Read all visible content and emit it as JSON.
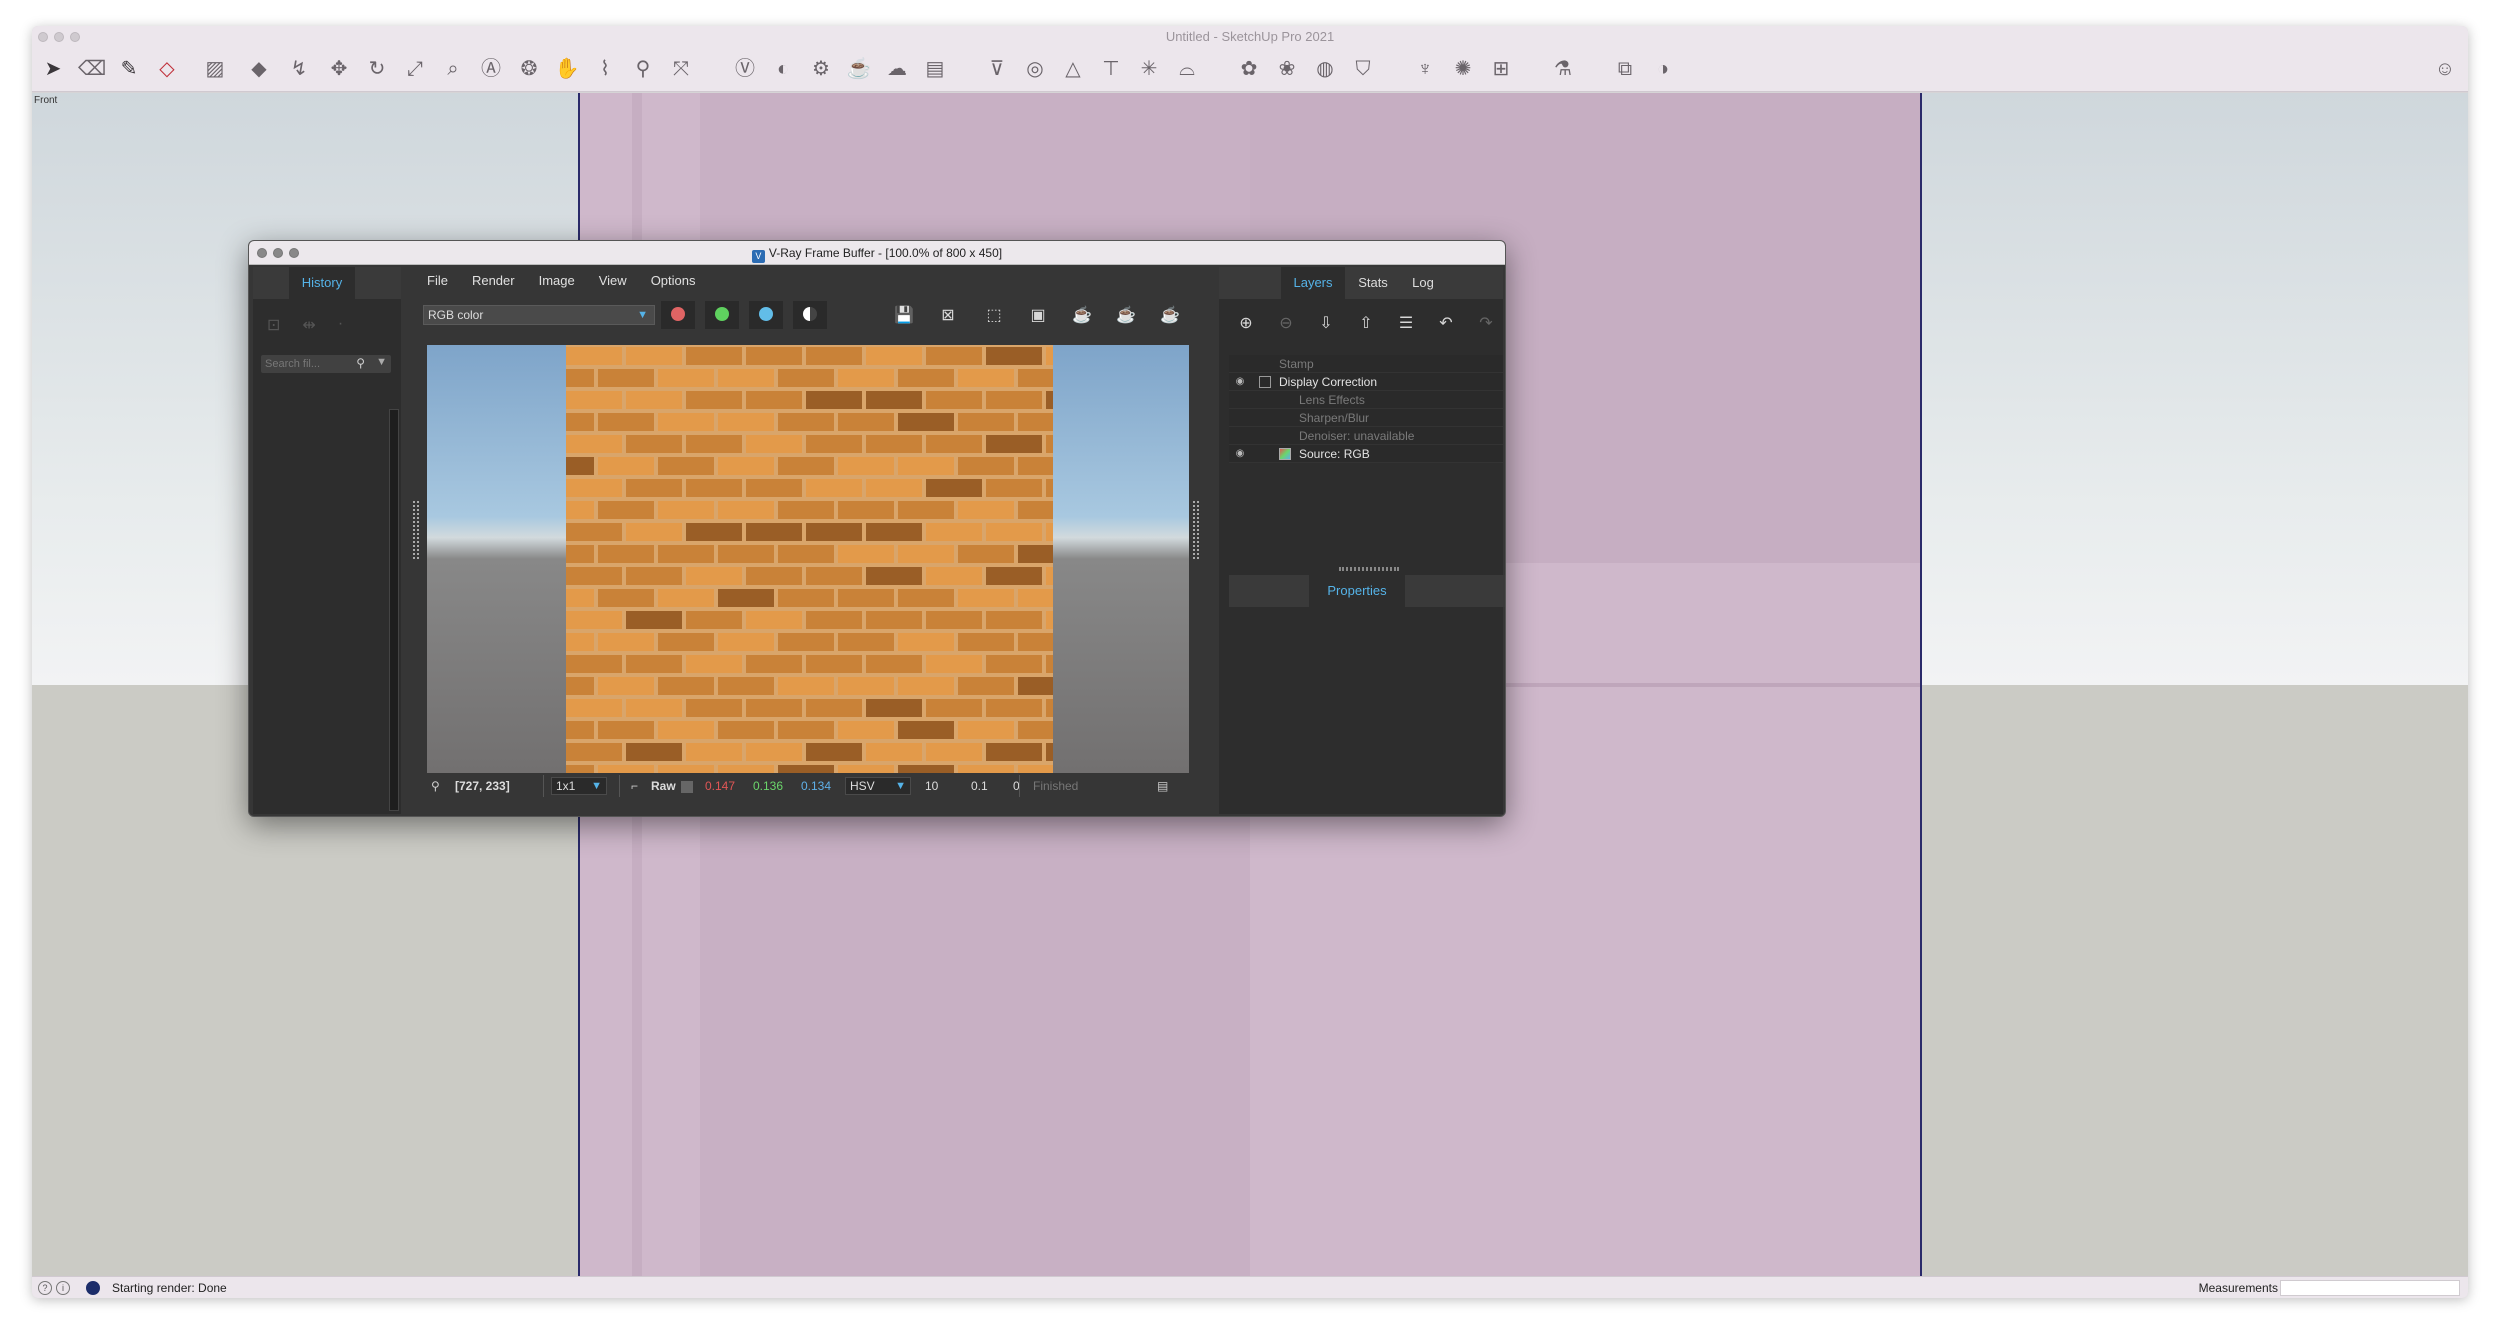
{
  "sketchup": {
    "window_title": "Untitled - SketchUp Pro 2021",
    "view_label": "Front",
    "status_text": "Starting render: Done",
    "measurements_label": "Measurements"
  },
  "vfb": {
    "window_title": "V-Ray Frame Buffer - [100.0% of 800 x 450]",
    "logo_letter": "V",
    "history_tab": "History",
    "search_placeholder": "Search fil...",
    "menu": [
      "File",
      "Render",
      "Image",
      "View",
      "Options"
    ],
    "channel": "RGB color",
    "channel_dots": {
      "red": "#e06464",
      "green": "#5fd15f",
      "blue": "#62bde8"
    },
    "status": {
      "coords": "[727, 233]",
      "zoom": "1x1",
      "raw_label": "Raw",
      "r": "0.147",
      "g": "0.136",
      "b": "0.134",
      "color_space": "HSV",
      "val1": "10",
      "val2": "0.1",
      "val3": "0",
      "state": "Finished"
    },
    "right_tabs": [
      "Layers",
      "Stats",
      "Log"
    ],
    "layers": [
      {
        "name": "Stamp",
        "dimmed": true,
        "eye": false
      },
      {
        "name": "Display Correction",
        "dimmed": false,
        "eye": true
      },
      {
        "name": "Lens Effects",
        "dimmed": true,
        "eye": false
      },
      {
        "name": "Sharpen/Blur",
        "dimmed": true,
        "eye": false
      },
      {
        "name": "Denoiser: unavailable",
        "dimmed": true,
        "eye": false
      },
      {
        "name": "Source: RGB",
        "dimmed": false,
        "eye": true
      }
    ],
    "properties_tab": "Properties"
  },
  "colors": {
    "accent": "#55b3e8",
    "r_value": "#e05656",
    "g_value": "#6bd66b",
    "b_value": "#5fb0e8",
    "brick_light": "#e39a4a",
    "brick_mid": "#c98238",
    "brick_dark": "#9a5e26"
  }
}
